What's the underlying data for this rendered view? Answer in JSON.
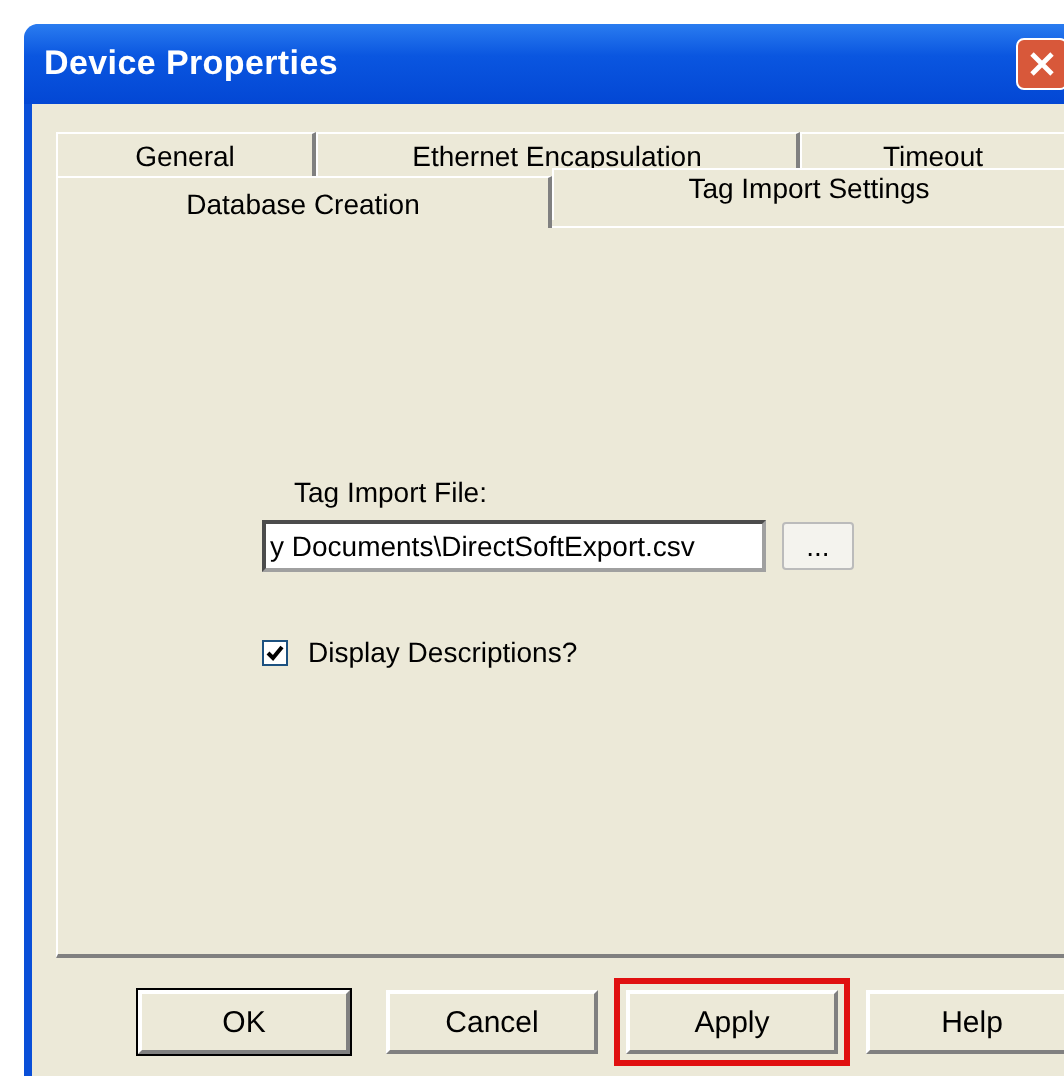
{
  "window": {
    "title": "Device Properties"
  },
  "tab_rows": [
    {
      "tabs": [
        {
          "label": "General",
          "selected": false
        },
        {
          "label": "Ethernet Encapsulation",
          "selected": false
        },
        {
          "label": "Timeout",
          "selected": false
        }
      ]
    },
    {
      "tabs": [
        {
          "label": "Database Creation",
          "selected": false
        },
        {
          "label": "Tag Import Settings",
          "selected": true
        }
      ]
    }
  ],
  "tag_import_file": {
    "label": "Tag Import File:",
    "value": "y Documents\\DirectSoftExport.csv",
    "browse_button": "..."
  },
  "display_descriptions": {
    "label": "Display Descriptions?",
    "checked": true
  },
  "buttons": [
    {
      "label": "OK",
      "default": true,
      "highlighted": false
    },
    {
      "label": "Cancel",
      "default": false,
      "highlighted": false
    },
    {
      "label": "Apply",
      "default": false,
      "highlighted": true
    },
    {
      "label": "Help",
      "default": false,
      "highlighted": false
    }
  ]
}
